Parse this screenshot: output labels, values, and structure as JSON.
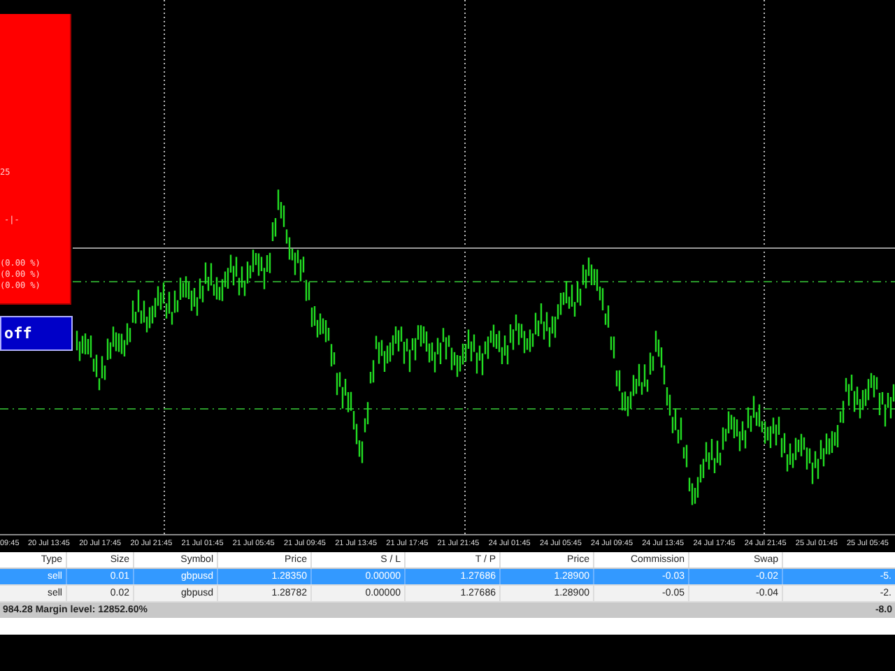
{
  "overlay_panel": {
    "texts": [
      "25",
      "-|-",
      "(0.00 %)",
      "(0.00 %)",
      "(0.00 %)"
    ]
  },
  "toggle_button": {
    "label": "off"
  },
  "time_axis": [
    "09:45",
    "20 Jul 13:45",
    "20 Jul 17:45",
    "20 Jul 21:45",
    "21 Jul 01:45",
    "21 Jul 05:45",
    "21 Jul 09:45",
    "21 Jul 13:45",
    "21 Jul 17:45",
    "21 Jul 21:45",
    "24 Jul 01:45",
    "24 Jul 05:45",
    "24 Jul 09:45",
    "24 Jul 13:45",
    "24 Jul 17:45",
    "24 Jul 21:45",
    "25 Jul 01:45",
    "25 Jul 05:45"
  ],
  "table": {
    "columns": [
      "Type",
      "Size",
      "Symbol",
      "Price",
      "S / L",
      "T / P",
      "Price",
      "Commission",
      "Swap"
    ],
    "rows": [
      {
        "selected": true,
        "cells": [
          "sell",
          "0.01",
          "gbpusd",
          "1.28350",
          "0.00000",
          "1.27686",
          "1.28900",
          "-0.03",
          "-0.02",
          "-5."
        ]
      },
      {
        "selected": false,
        "cells": [
          "sell",
          "0.02",
          "gbpusd",
          "1.28782",
          "0.00000",
          "1.27686",
          "1.28900",
          "-0.05",
          "-0.04",
          "-2."
        ]
      }
    ]
  },
  "status_bar": {
    "summary": "984.28  Margin level: 12852.60%",
    "total": "-8.0"
  }
}
